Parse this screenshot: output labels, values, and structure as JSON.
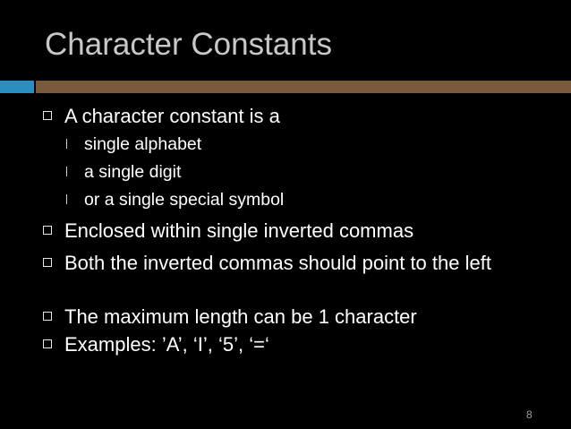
{
  "slide": {
    "title": "Character Constants",
    "page_number": "8",
    "colors": {
      "background": "#000000",
      "title": "#c8c8c8",
      "accent_blue": "#2a8ec0",
      "accent_brown": "#7a5a3a",
      "text": "#ffffff"
    },
    "bullets": [
      {
        "text": "A character constant is a",
        "sub_bullets": [
          "single alphabet",
          "a single digit",
          "or a single special symbol"
        ]
      },
      {
        "text": "Enclosed within single inverted commas"
      },
      {
        "text": "Both the inverted commas should point to the left"
      },
      {
        "text": "The maximum length can be 1 character"
      },
      {
        "text": "Examples: ’A’, ‘I’, ‘5’, ‘=‘"
      }
    ]
  }
}
